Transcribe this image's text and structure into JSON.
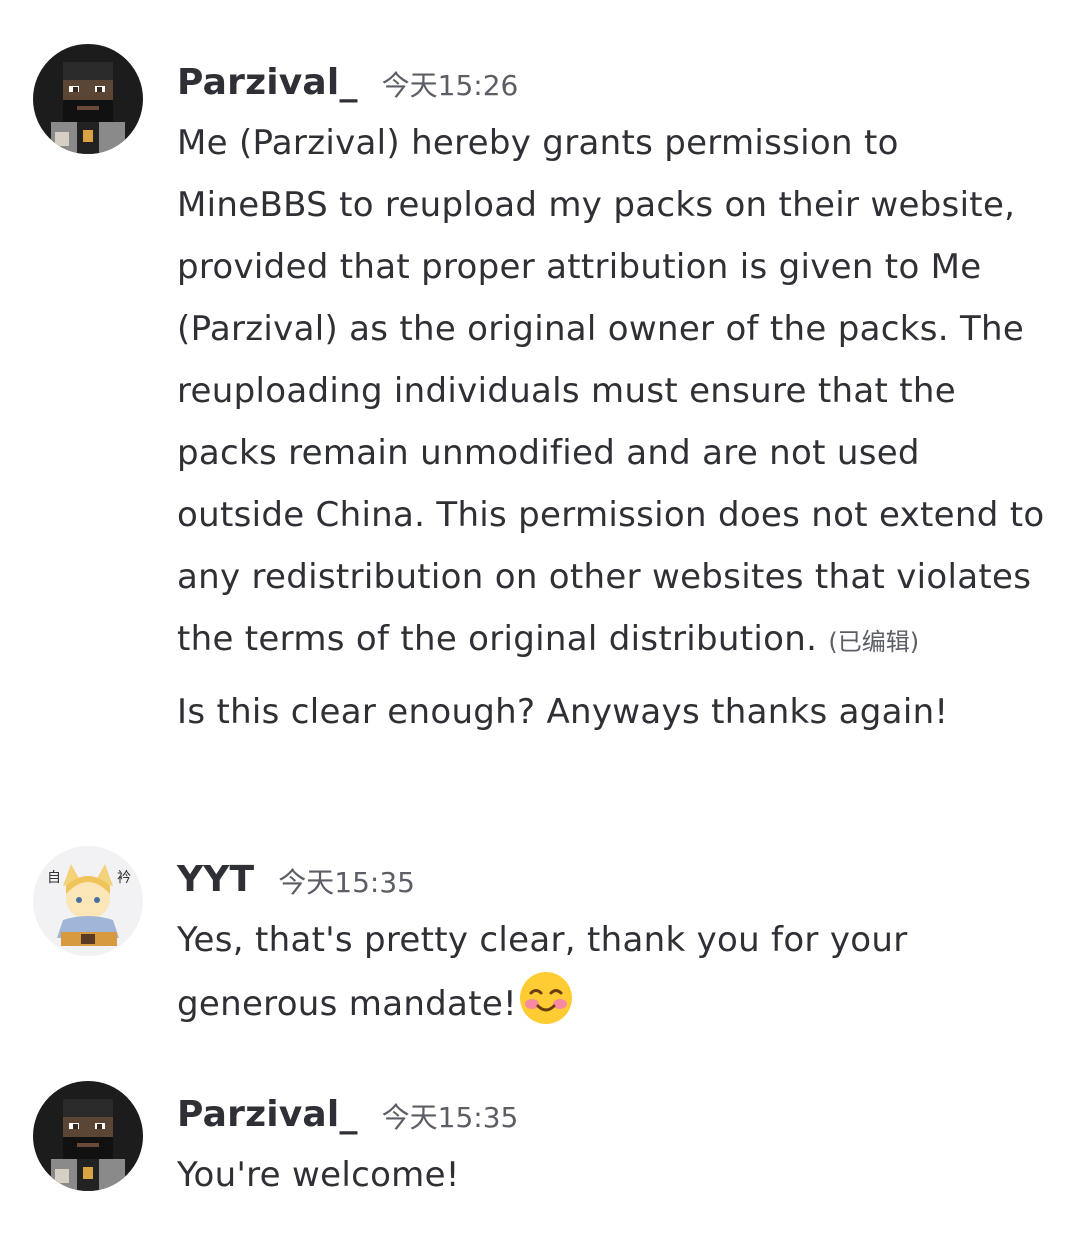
{
  "messages": [
    {
      "username": "Parzival_",
      "timestamp": "今天15:26",
      "avatar_icon": "pixel-bearded-man-avatar",
      "text": "Me (Parzival) hereby grants permission to MineBBS to reupload my packs on their website, provided that proper attribution is given to Me (Parzival) as the original owner of the packs. The reuploading individuals must ensure that the packs remain unmodified and are not used outside China. This permission does not extend to any redistribution on other websites that violates the terms of the original distribution.",
      "edited_label": "(已编辑)",
      "followup_text": "Is this clear enough? Anyways thanks again!"
    },
    {
      "username": "YYT",
      "timestamp": "今天15:35",
      "avatar_icon": "anime-fox-girl-avatar",
      "text": "Yes, that's pretty clear, thank you for your generous mandate!",
      "emoji": "smiling-blushing-face-emoji"
    },
    {
      "username": "Parzival_",
      "timestamp": "今天15:35",
      "avatar_icon": "pixel-bearded-man-avatar",
      "text": "You're welcome!"
    }
  ],
  "colors": {
    "background": "#ffffff",
    "username": "#2e3035",
    "text": "#2e3035",
    "timestamp": "#5c5e66"
  }
}
